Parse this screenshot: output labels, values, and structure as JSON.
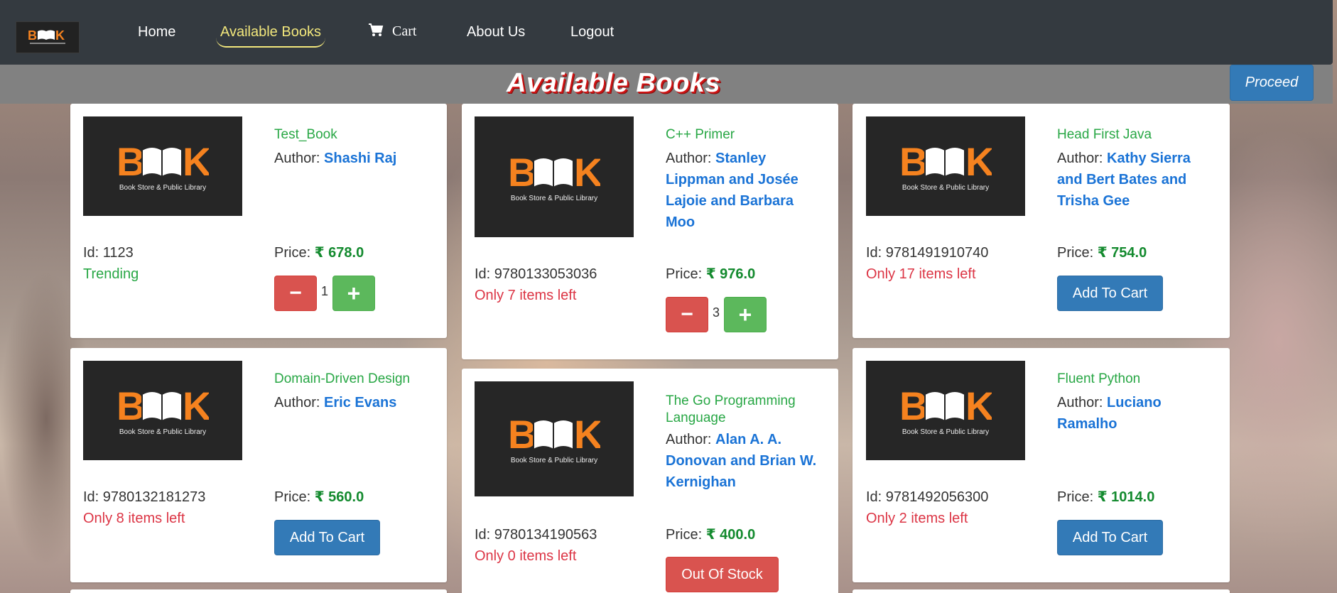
{
  "nav": {
    "logo_text": "BOOK",
    "logo_subtitle": "Book Store & Public Library",
    "items": [
      {
        "label": "Home"
      },
      {
        "label": "Available Books"
      },
      {
        "label": "Cart"
      },
      {
        "label": "About Us"
      },
      {
        "label": "Logout"
      }
    ],
    "active_color": "#f2e77c",
    "background": "#343a40"
  },
  "header": {
    "title": "Available Books",
    "proceed_label": "Proceed"
  },
  "books": [
    {
      "title": "Test_Book",
      "author_prefix": "Author: ",
      "author": "Shashi Raj",
      "id_text": "Id: 1123",
      "stock_text": "Trending",
      "price_prefix": "Price: ",
      "price": "₹ 678.0",
      "quantity": "1",
      "image_title": "BOOK",
      "image_subtitle": "Book Store & Public Library"
    },
    {
      "title": "C++ Primer",
      "author_prefix": "Author: ",
      "author": "Stanley Lippman and Josée Lajoie and Barbara Moo",
      "id_text": "Id: 9780133053036",
      "stock_text": "Only 7 items left",
      "price_prefix": "Price: ",
      "price": "₹ 976.0",
      "quantity": "3",
      "image_title": "BOOK",
      "image_subtitle": "Book Store & Public Library"
    },
    {
      "title": "Head First Java",
      "author_prefix": "Author: ",
      "author": "Kathy Sierra and Bert Bates and Trisha Gee",
      "id_text": "Id: 9781491910740",
      "stock_text": "Only 17 items left",
      "price_prefix": "Price: ",
      "price": "₹ 754.0",
      "button_label": "Add To Cart",
      "image_title": "BOOK",
      "image_subtitle": "Book Store & Public Library"
    },
    {
      "title": "Domain-Driven Design",
      "author_prefix": "Author: ",
      "author": "Eric Evans",
      "id_text": "Id: 9780132181273",
      "stock_text": "Only 8 items left",
      "price_prefix": "Price: ",
      "price": "₹ 560.0",
      "button_label": "Add To Cart",
      "image_title": "BOOK",
      "image_subtitle": "Book Store & Public Library"
    },
    {
      "title": "The Go Programming Language",
      "author_prefix": "Author: ",
      "author": "Alan A. A. Donovan and Brian W. Kernighan",
      "id_text": "Id: 9780134190563",
      "stock_text": "Only 0 items left",
      "price_prefix": "Price: ",
      "price": "₹ 400.0",
      "button_label": "Out Of Stock",
      "image_title": "BOOK",
      "image_subtitle": "Book Store & Public Library"
    },
    {
      "title": "Fluent Python",
      "author_prefix": "Author: ",
      "author": "Luciano Ramalho",
      "id_text": "Id: 9781492056300",
      "stock_text": "Only 2 items left",
      "price_prefix": "Price: ",
      "price": "₹ 1014.0",
      "button_label": "Add To Cart",
      "image_title": "BOOK",
      "image_subtitle": "Book Store & Public Library"
    }
  ],
  "controls": {
    "minus": "−",
    "plus": "+"
  },
  "icons": {
    "cart": "cart-icon",
    "book_logo": "open-book-icon"
  },
  "colors": {
    "title_green": "#28a745",
    "author_blue": "#1a73d6",
    "price_green": "#138a2e",
    "stock_red": "#dc3545",
    "btn_blue": "#337ab7",
    "btn_red": "#d9534f",
    "btn_green": "#5cb85c"
  }
}
